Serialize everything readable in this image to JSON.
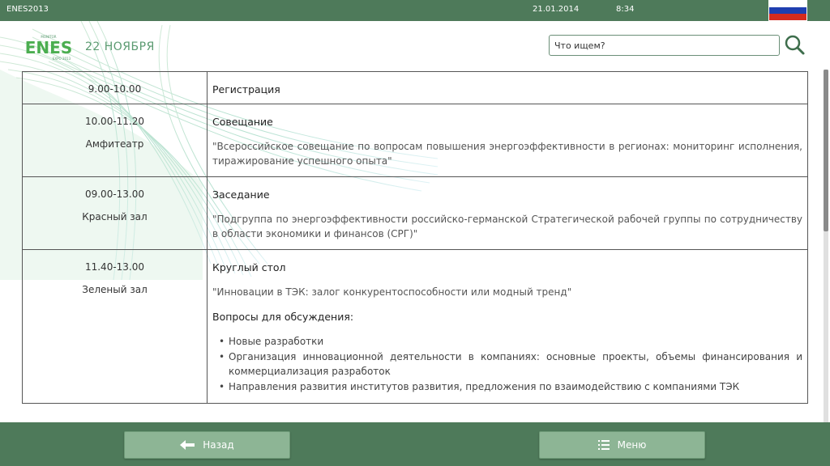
{
  "status": {
    "app_name": "ENES2013",
    "date": "21.01.2014",
    "time": "8:34"
  },
  "header": {
    "logo_text": "ENES",
    "logo_sub_top": "MONITOR",
    "logo_sub_bottom": "EXPO 2013",
    "date_title": "22 НОЯБРЯ",
    "search_placeholder": "Что ищем?"
  },
  "schedule": [
    {
      "time": "9.00-10.00",
      "place": "",
      "type": "Регистрация",
      "description": "",
      "questions_title": "",
      "questions": []
    },
    {
      "time": "10.00-11.20",
      "place": "Амфитеатр",
      "type": "Совещание",
      "description": "\"Всероссийское совещание по вопросам повышения энергоэффективности в регионах: мониторинг исполнения, тиражирование успешного опыта\"",
      "questions_title": "",
      "questions": []
    },
    {
      "time": "09.00-13.00",
      "place": "Красный зал",
      "type": "Заседание",
      "description": "\"Подгруппа по энергоэффективности российско-германской Стратегической рабочей группы по сотрудничеству в области экономики и финансов (СРГ)\"",
      "questions_title": "",
      "questions": []
    },
    {
      "time": "11.40-13.00",
      "place": "Зеленый зал",
      "type": "Круглый стол",
      "description": "\"Инновации в ТЭК: залог конкурентоспособности или модный тренд\"",
      "questions_title": "Вопросы для обсуждения:",
      "questions": [
        "Новые разработки",
        "Организация инновационной деятельности в компаниях: основные проекты, объемы финансирования и коммерциализация разработок",
        "Направления развития институтов развития, предложения по взаимодействию с компаниями ТЭК"
      ]
    }
  ],
  "footer": {
    "back_label": "Назад",
    "menu_label": "Меню"
  },
  "icons": {
    "flag": "russia-flag-icon",
    "search": "search-icon",
    "back": "arrow-left-icon",
    "menu": "list-icon"
  },
  "colors": {
    "bar": "#4e7a5a",
    "button": "#8db595",
    "accent": "#5a9a70"
  }
}
